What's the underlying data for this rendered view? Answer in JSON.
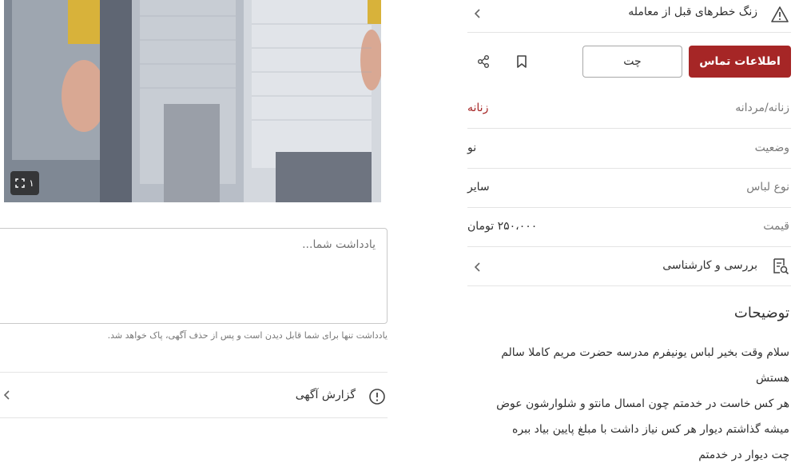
{
  "photo": {
    "counter": "۱"
  },
  "note": {
    "placeholder": "یادداشت شما...",
    "hint": "یادداشت تنها برای شما قابل دیدن است و پس از حذف آگهی، پاک خواهد شد."
  },
  "report": {
    "label": "گزارش آگهی"
  },
  "risk": {
    "label": "زنگ خطرهای قبل از معامله"
  },
  "actions": {
    "contact_label": "اطلاعات تماس",
    "chat_label": "چت"
  },
  "attributes": [
    {
      "key": "زنانه/مردانه",
      "value": "زنانه",
      "highlight": true
    },
    {
      "key": "وضعیت",
      "value": "نو",
      "highlight": false
    },
    {
      "key": "نوع لباس",
      "value": "سایر",
      "highlight": false
    },
    {
      "key": "قیمت",
      "value": "۲۵۰،۰۰۰ تومان",
      "highlight": false
    }
  ],
  "review": {
    "label": "بررسی و کارشناسی"
  },
  "description": {
    "title": "توضیحات",
    "lines": [
      "سلام وقت بخیر لباس یونیفرم مدرسه حضرت مریم کاملا سالم",
      "هستش",
      "هر کس خاست در خدمتم چون امسال مانتو و شلوارشون عوض",
      "میشه گذاشتم دیوار هر کس نیاز داشت با مبلغ پایین بیاد ببره",
      "چت دیوار در خدمتم"
    ]
  },
  "colors": {
    "brand": "#a62626",
    "divider": "#e4e4e4",
    "muted_text": "#7a7a7a"
  }
}
